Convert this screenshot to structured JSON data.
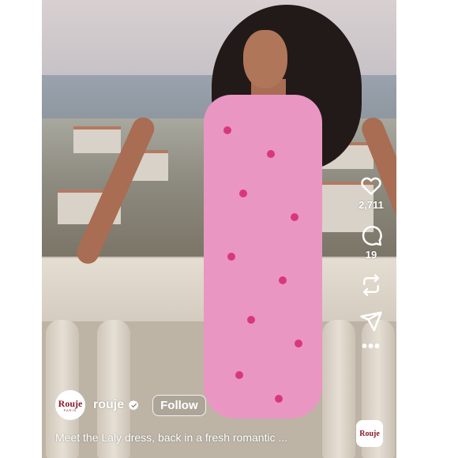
{
  "reel": {
    "likes_count": "2,711",
    "comments_count": "19",
    "author": {
      "username": "rouje",
      "avatar_brand": "Rouje",
      "avatar_sub": "PARIS",
      "follow_label": "Follow"
    },
    "caption": "Meet the Laly dress, back in a fresh romantic ...",
    "audio_thumb_brand": "Rouje",
    "more_label": "•••"
  },
  "colors": {
    "dress": "#ea96c2",
    "brand": "#8b1a2a",
    "icon": "#ffffff"
  },
  "icons": [
    "heart-icon",
    "comment-icon",
    "repost-icon",
    "share-icon",
    "more-icon",
    "verified-icon"
  ]
}
